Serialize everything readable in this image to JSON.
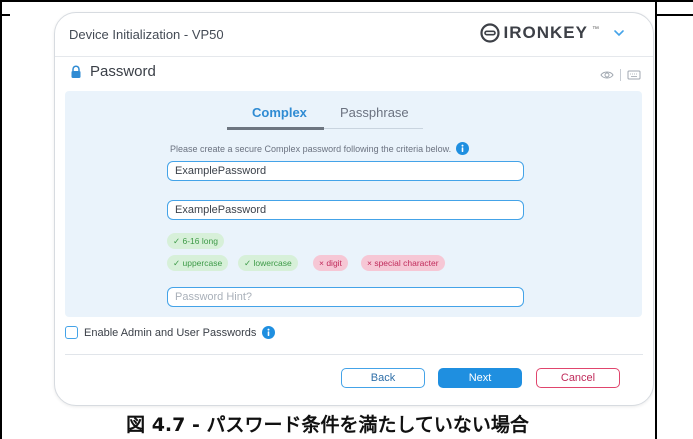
{
  "window": {
    "title": "Device Initialization - VP50",
    "brand": "IRONKEY",
    "brand_tm": "™"
  },
  "section": {
    "title": "Password"
  },
  "tabs": [
    {
      "label": "Complex",
      "active": true
    },
    {
      "label": "Passphrase",
      "active": false
    }
  ],
  "instruction": "Please create a secure Complex password following the criteria below.",
  "fields": {
    "password_value": "ExamplePassword",
    "confirm_value": "ExamplePassword",
    "hint_placeholder": "Password Hint?"
  },
  "criteria": {
    "length": {
      "label": "✓ 6-16 long",
      "met": true
    },
    "items": [
      {
        "label": "✓ uppercase",
        "met": true
      },
      {
        "label": "✓ lowercase",
        "met": true
      },
      {
        "label": "× digit",
        "met": false
      },
      {
        "label": "× special character",
        "met": false
      }
    ]
  },
  "admin_option": {
    "label": "Enable Admin and User Passwords",
    "checked": false
  },
  "buttons": {
    "back": "Back",
    "next": "Next",
    "cancel": "Cancel"
  },
  "caption": "図 4.7 - パスワード条件を満たしていない場合",
  "colors": {
    "accent": "#1f8fe0",
    "ok_bg": "#d7f0d9",
    "ok_text": "#3d9a47",
    "bad_bg": "#f6c7d5",
    "bad_text": "#c02b5b",
    "panel_bg": "#eaf3fb"
  },
  "icons": [
    "ironkey-logo-icon",
    "chevron-down-icon",
    "lock-icon",
    "eye-icon",
    "keyboard-icon",
    "info-icon"
  ]
}
